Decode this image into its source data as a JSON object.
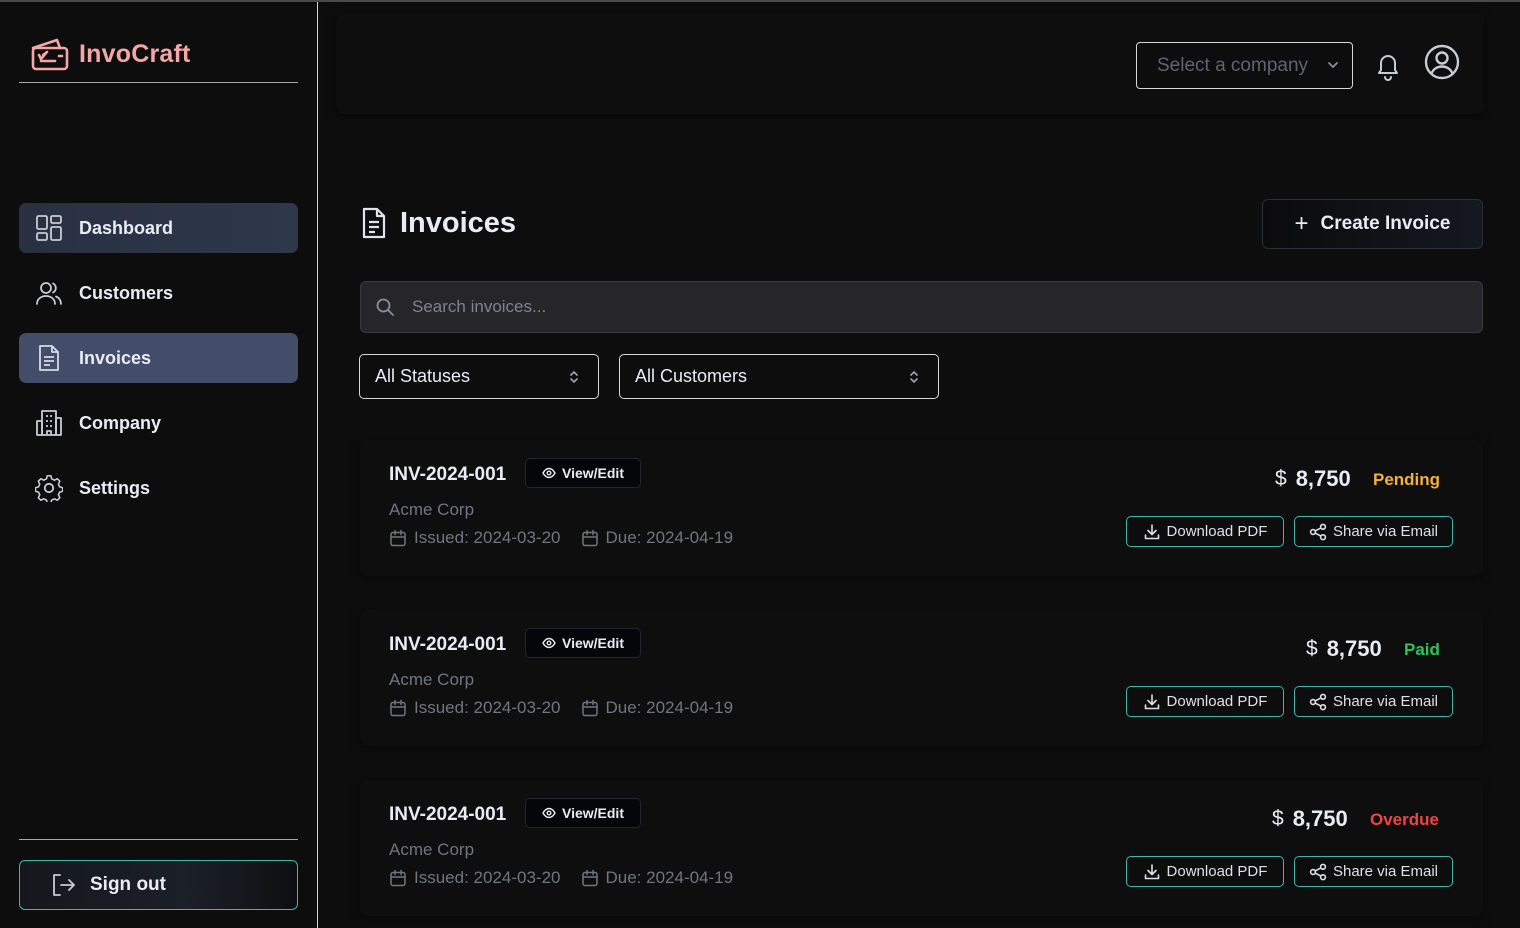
{
  "app": {
    "name": "InvoCraft"
  },
  "sidebar": {
    "items": [
      {
        "label": "Dashboard",
        "icon": "dashboard-grid-icon"
      },
      {
        "label": "Customers",
        "icon": "users-icon"
      },
      {
        "label": "Invoices",
        "icon": "document-icon"
      },
      {
        "label": "Company",
        "icon": "building-icon"
      },
      {
        "label": "Settings",
        "icon": "gear-icon"
      }
    ],
    "sign_out": "Sign out"
  },
  "header": {
    "company_select": "Select a company"
  },
  "page": {
    "title": "Invoices",
    "create_button": "Create Invoice",
    "search_placeholder": "Search invoices...",
    "filters": {
      "status": "All Statuses",
      "customer": "All Customers"
    }
  },
  "invoices": [
    {
      "number": "INV-2024-001",
      "view_label": "View/Edit",
      "customer": "Acme Corp",
      "issued": "Issued: 2024-03-20",
      "due": "Due: 2024-04-19",
      "currency": "$",
      "amount": "8,750",
      "status": "Pending",
      "status_color": "#f2b233",
      "download_label": "Download PDF",
      "share_label": "Share via Email"
    },
    {
      "number": "INV-2024-001",
      "view_label": "View/Edit",
      "customer": "Acme Corp",
      "issued": "Issued: 2024-03-20",
      "due": "Due: 2024-04-19",
      "currency": "$",
      "amount": "8,750",
      "status": "Paid",
      "status_color": "#2fc25b",
      "download_label": "Download PDF",
      "share_label": "Share via Email"
    },
    {
      "number": "INV-2024-001",
      "view_label": "View/Edit",
      "customer": "Acme Corp",
      "issued": "Issued: 2024-03-20",
      "due": "Due: 2024-04-19",
      "currency": "$",
      "amount": "8,750",
      "status": "Overdue",
      "status_color": "#ef4444",
      "download_label": "Download PDF",
      "share_label": "Share via Email"
    }
  ],
  "colors": {
    "brand": "#f4a6a6",
    "accent_border": "#3fb6aa",
    "active_nav": "#434c68"
  }
}
